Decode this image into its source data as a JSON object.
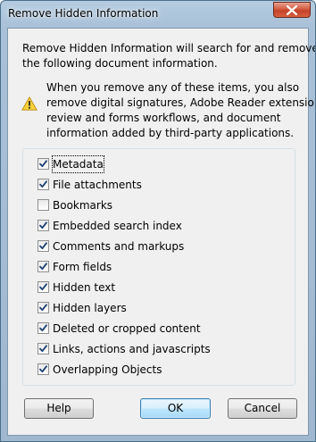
{
  "window": {
    "title": "Remove Hidden Information"
  },
  "intro": {
    "lines": [
      "Remove Hidden Information will search for and remove",
      "the following document information."
    ]
  },
  "warning": {
    "icon": "warning-icon",
    "lines": [
      "When you remove any of these items, you also",
      "remove digital signatures, Adobe Reader extensions,",
      "review and forms workflows, and document",
      "information added by third-party applications."
    ]
  },
  "options": [
    {
      "label": "Metadata",
      "checked": true
    },
    {
      "label": "File attachments",
      "checked": true
    },
    {
      "label": "Bookmarks",
      "checked": false
    },
    {
      "label": "Embedded search index",
      "checked": true
    },
    {
      "label": "Comments and markups",
      "checked": true
    },
    {
      "label": "Form fields",
      "checked": true
    },
    {
      "label": "Hidden text",
      "checked": true
    },
    {
      "label": "Hidden layers",
      "checked": true
    },
    {
      "label": "Deleted or cropped content",
      "checked": true
    },
    {
      "label": "Links, actions and javascripts",
      "checked": true
    },
    {
      "label": "Overlapping Objects",
      "checked": true
    }
  ],
  "buttons": {
    "help": "Help",
    "ok": "OK",
    "cancel": "Cancel"
  }
}
